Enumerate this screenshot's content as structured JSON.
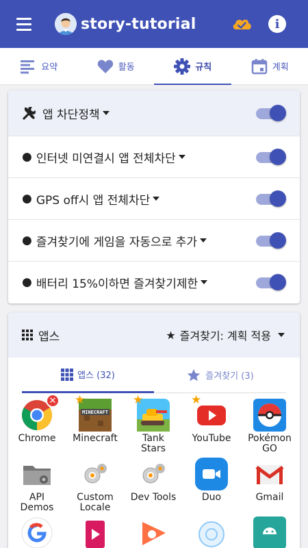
{
  "appbar": {
    "title": "story-tutorial"
  },
  "tabs": [
    {
      "label": "요약",
      "icon": "summary-icon"
    },
    {
      "label": "활동",
      "icon": "heart-icon"
    },
    {
      "label": "규칙",
      "icon": "gear-icon",
      "active": true
    },
    {
      "label": "계획",
      "icon": "calendar-icon"
    }
  ],
  "policy": {
    "title": "앱 차단정책",
    "enabled": true,
    "rules": [
      {
        "label": "인터넷 미연결시 앱 전체차단",
        "enabled": true
      },
      {
        "label": "GPS off시 앱 전체차단",
        "enabled": true
      },
      {
        "label": "즐겨찾기에 게임을 자동으로 추가",
        "enabled": true
      },
      {
        "label": "배터리 15%이하면 즐겨찾기제한",
        "enabled": true
      }
    ]
  },
  "apps_card": {
    "title": "앱스",
    "favorites_selector": "즐겨찾기: 계획 적용",
    "subtabs": [
      {
        "label": "앱스 (32)",
        "active": true
      },
      {
        "label": "즐겨찾기 (3)",
        "active": false
      }
    ],
    "apps": [
      {
        "name": "Chrome",
        "favorite": false,
        "removable": true,
        "icon": "chrome-icon"
      },
      {
        "name": "Minecraft",
        "favorite": true,
        "icon": "minecraft-icon"
      },
      {
        "name": "Tank\nStars",
        "favorite": true,
        "icon": "tank-stars-icon"
      },
      {
        "name": "YouTube",
        "favorite": true,
        "icon": "youtube-icon"
      },
      {
        "name": "Pokémon\nGO",
        "favorite": false,
        "icon": "pokemon-go-icon"
      },
      {
        "name": "API\nDemos",
        "favorite": false,
        "icon": "api-demos-icon"
      },
      {
        "name": "Custom\nLocale",
        "favorite": false,
        "icon": "custom-locale-icon"
      },
      {
        "name": "Dev Tools",
        "favorite": false,
        "icon": "dev-tools-icon"
      },
      {
        "name": "Duo",
        "favorite": false,
        "icon": "duo-icon"
      },
      {
        "name": "Gmail",
        "favorite": false,
        "icon": "gmail-icon"
      },
      {
        "name": "",
        "favorite": false,
        "icon": "google-icon"
      },
      {
        "name": "",
        "favorite": false,
        "icon": "play-movies-icon"
      },
      {
        "name": "",
        "favorite": false,
        "icon": "play-music-icon"
      },
      {
        "name": "",
        "favorite": false,
        "icon": "webview-shell-icon"
      },
      {
        "name": "",
        "favorite": false,
        "icon": "android-app-icon"
      }
    ]
  },
  "colors": {
    "primary": "#3f51b5",
    "toggle_track": "#9fa8da",
    "header_bg": "#eef0f9",
    "star": "#f5a300",
    "remove": "#e53935"
  }
}
